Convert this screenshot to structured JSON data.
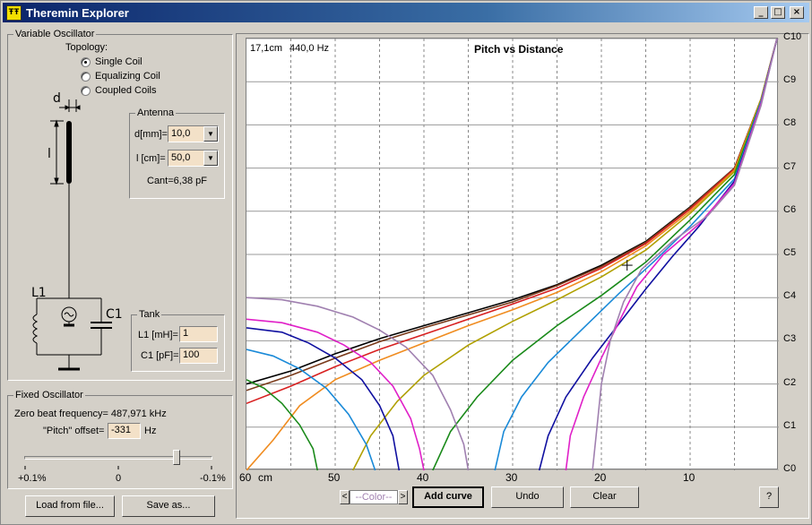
{
  "window": {
    "title": "Theremin Explorer",
    "icon_text": "ŦŦ",
    "minimize": "_",
    "maximize": "□",
    "close": "×"
  },
  "variable_osc": {
    "title": "Variable Oscillator",
    "topology_label": "Topology:",
    "options": [
      "Single Coil",
      "Equalizing Coil",
      "Coupled Coils"
    ],
    "selected": "Single Coil",
    "diagram_labels": {
      "d": "d",
      "l": "l",
      "l1": "L1",
      "c1": "C1"
    }
  },
  "antenna": {
    "title": "Antenna",
    "d_label": "d[mm]=",
    "d_value": "10,0",
    "l_label": "l [cm]=",
    "l_value": "50,0",
    "cant": "Cant=6,38 pF"
  },
  "tank": {
    "title": "Tank",
    "l1_label": "L1 [mH]=",
    "l1_value": "1",
    "c1_label": "C1 [pF]=",
    "c1_value": "100"
  },
  "fixed_osc": {
    "title": "Fixed Oscillator",
    "zero_beat": "Zero beat frequency= 487,971 kHz",
    "pitch_label": "\"Pitch\" offset=",
    "pitch_value": "-331",
    "pitch_unit": "Hz",
    "slider_labels": [
      "+0.1%",
      "0",
      "-0.1%"
    ],
    "slider_level": 0.81
  },
  "buttons": {
    "load": "Load  from  file...",
    "save": "Save as...",
    "color_prev": "<",
    "color_label": "--Color--",
    "color_next": ">",
    "add_curve": "Add curve",
    "undo": "Undo",
    "clear": "Clear",
    "help": "?"
  },
  "chart_data": {
    "type": "line",
    "title": "Pitch vs Distance",
    "readout": {
      "distance": "17,1cm",
      "frequency": "440,0 Hz"
    },
    "x_ticks": [
      "60",
      "50",
      "40",
      "30",
      "20",
      "10"
    ],
    "x_unit": "cm",
    "xlim": [
      60,
      0
    ],
    "y_ticks": [
      "C0",
      "C1",
      "C2",
      "C3",
      "C4",
      "C5",
      "C6",
      "C7",
      "C8",
      "C9",
      "C10"
    ],
    "ylim": [
      0,
      10
    ],
    "series": [
      {
        "color": "#000000",
        "points": [
          [
            60,
            2.0
          ],
          [
            55,
            2.3
          ],
          [
            50,
            2.7
          ],
          [
            45,
            3.05
          ],
          [
            40,
            3.35
          ],
          [
            35,
            3.65
          ],
          [
            30,
            3.95
          ],
          [
            25,
            4.3
          ],
          [
            20,
            4.75
          ],
          [
            15,
            5.3
          ],
          [
            10,
            6.1
          ],
          [
            5,
            7.0
          ],
          [
            2,
            8.6
          ],
          [
            0.2,
            10.0
          ]
        ]
      },
      {
        "color": "#7a3a1a",
        "points": [
          [
            60,
            1.85
          ],
          [
            55,
            2.2
          ],
          [
            50,
            2.6
          ],
          [
            45,
            2.98
          ],
          [
            40,
            3.3
          ],
          [
            35,
            3.6
          ],
          [
            30,
            3.9
          ],
          [
            25,
            4.28
          ],
          [
            20,
            4.72
          ],
          [
            15,
            5.28
          ],
          [
            10,
            6.08
          ],
          [
            5,
            7.0
          ],
          [
            2,
            8.6
          ],
          [
            0.2,
            10.0
          ]
        ]
      },
      {
        "color": "#d82020",
        "points": [
          [
            60,
            1.55
          ],
          [
            55,
            1.95
          ],
          [
            50,
            2.4
          ],
          [
            45,
            2.8
          ],
          [
            40,
            3.15
          ],
          [
            35,
            3.5
          ],
          [
            30,
            3.85
          ],
          [
            25,
            4.22
          ],
          [
            20,
            4.68
          ],
          [
            15,
            5.25
          ],
          [
            10,
            6.05
          ],
          [
            5,
            6.98
          ],
          [
            2,
            8.6
          ],
          [
            0.2,
            10.0
          ]
        ]
      },
      {
        "color": "#f08c20",
        "points": [
          [
            60,
            0
          ],
          [
            57,
            0.7
          ],
          [
            54,
            1.5
          ],
          [
            50,
            2.1
          ],
          [
            45,
            2.55
          ],
          [
            40,
            2.95
          ],
          [
            35,
            3.35
          ],
          [
            30,
            3.72
          ],
          [
            25,
            4.12
          ],
          [
            20,
            4.6
          ],
          [
            15,
            5.2
          ],
          [
            10,
            6.0
          ],
          [
            5,
            6.95
          ],
          [
            2,
            8.6
          ],
          [
            0.2,
            10.0
          ]
        ]
      },
      {
        "color": "#b0a000",
        "points": [
          [
            48,
            0
          ],
          [
            46,
            0.8
          ],
          [
            43,
            1.6
          ],
          [
            40,
            2.2
          ],
          [
            35,
            2.9
          ],
          [
            30,
            3.45
          ],
          [
            25,
            3.95
          ],
          [
            20,
            4.48
          ],
          [
            15,
            5.1
          ],
          [
            10,
            5.95
          ],
          [
            5,
            6.92
          ],
          [
            2,
            8.6
          ],
          [
            0.2,
            10.0
          ]
        ]
      },
      {
        "color": "#1a8a1a",
        "points": [
          [
            39,
            0
          ],
          [
            37,
            0.9
          ],
          [
            34,
            1.7
          ],
          [
            30,
            2.55
          ],
          [
            25,
            3.35
          ],
          [
            20,
            4.05
          ],
          [
            15,
            4.82
          ],
          [
            10,
            5.8
          ],
          [
            5,
            6.85
          ],
          [
            2,
            8.55
          ],
          [
            0.2,
            10.0
          ]
        ]
      },
      {
        "color": "#1a8ad8",
        "points": [
          [
            32,
            0
          ],
          [
            31,
            0.9
          ],
          [
            29,
            1.7
          ],
          [
            26,
            2.5
          ],
          [
            22,
            3.3
          ],
          [
            18,
            4.1
          ],
          [
            14,
            4.85
          ],
          [
            10,
            5.65
          ],
          [
            5,
            6.75
          ],
          [
            2,
            8.55
          ],
          [
            0.2,
            10.0
          ]
        ]
      },
      {
        "color": "#1010a0",
        "points": [
          [
            27,
            0
          ],
          [
            26,
            0.8
          ],
          [
            24,
            1.7
          ],
          [
            21,
            2.6
          ],
          [
            18,
            3.4
          ],
          [
            15,
            4.2
          ],
          [
            12,
            4.95
          ],
          [
            9,
            5.65
          ],
          [
            5,
            6.7
          ],
          [
            2,
            8.5
          ],
          [
            0.2,
            10.0
          ]
        ]
      },
      {
        "color": "#e020c8",
        "points": [
          [
            24,
            0
          ],
          [
            23.5,
            0.8
          ],
          [
            22,
            1.7
          ],
          [
            20,
            2.6
          ],
          [
            18,
            3.45
          ],
          [
            16,
            4.25
          ],
          [
            13,
            5.0
          ],
          [
            9,
            5.7
          ],
          [
            5,
            6.65
          ],
          [
            2,
            8.5
          ],
          [
            0.2,
            10.0
          ]
        ]
      },
      {
        "color": "#a080b0",
        "points": [
          [
            21,
            0
          ],
          [
            20.5,
            1.0
          ],
          [
            20,
            2.0
          ],
          [
            19,
            3.0
          ],
          [
            17.5,
            3.9
          ],
          [
            15.5,
            4.65
          ],
          [
            12,
            5.3
          ],
          [
            8,
            5.9
          ],
          [
            5,
            6.6
          ],
          [
            2,
            8.45
          ],
          [
            0.2,
            10.0
          ]
        ]
      },
      {
        "color": "#a080b0",
        "points": [
          [
            60,
            4.0
          ],
          [
            56,
            3.95
          ],
          [
            52,
            3.8
          ],
          [
            48,
            3.55
          ],
          [
            45,
            3.25
          ],
          [
            42,
            2.85
          ],
          [
            39,
            2.2
          ],
          [
            37,
            1.4
          ],
          [
            35.5,
            0.6
          ],
          [
            35,
            0
          ]
        ]
      },
      {
        "color": "#e020c8",
        "points": [
          [
            60,
            3.5
          ],
          [
            56,
            3.42
          ],
          [
            52,
            3.2
          ],
          [
            49,
            2.9
          ],
          [
            46,
            2.5
          ],
          [
            43.5,
            1.95
          ],
          [
            41.5,
            1.2
          ],
          [
            40.5,
            0.5
          ],
          [
            40,
            0
          ]
        ]
      },
      {
        "color": "#1010a0",
        "points": [
          [
            60,
            3.3
          ],
          [
            56,
            3.2
          ],
          [
            53,
            2.95
          ],
          [
            50,
            2.6
          ],
          [
            47,
            2.1
          ],
          [
            45,
            1.5
          ],
          [
            43.5,
            0.8
          ],
          [
            42.8,
            0
          ]
        ]
      },
      {
        "color": "#1a8ad8",
        "points": [
          [
            60,
            2.8
          ],
          [
            57,
            2.65
          ],
          [
            54,
            2.35
          ],
          [
            51,
            1.9
          ],
          [
            48.5,
            1.3
          ],
          [
            46.5,
            0.6
          ],
          [
            45.5,
            0
          ]
        ]
      },
      {
        "color": "#1a8a1a",
        "points": [
          [
            60,
            2.1
          ],
          [
            58,
            1.9
          ],
          [
            56,
            1.55
          ],
          [
            54,
            1.05
          ],
          [
            52.5,
            0.5
          ],
          [
            52,
            0
          ]
        ]
      }
    ],
    "cursor": {
      "x": 17.1,
      "y": 4.75
    }
  }
}
